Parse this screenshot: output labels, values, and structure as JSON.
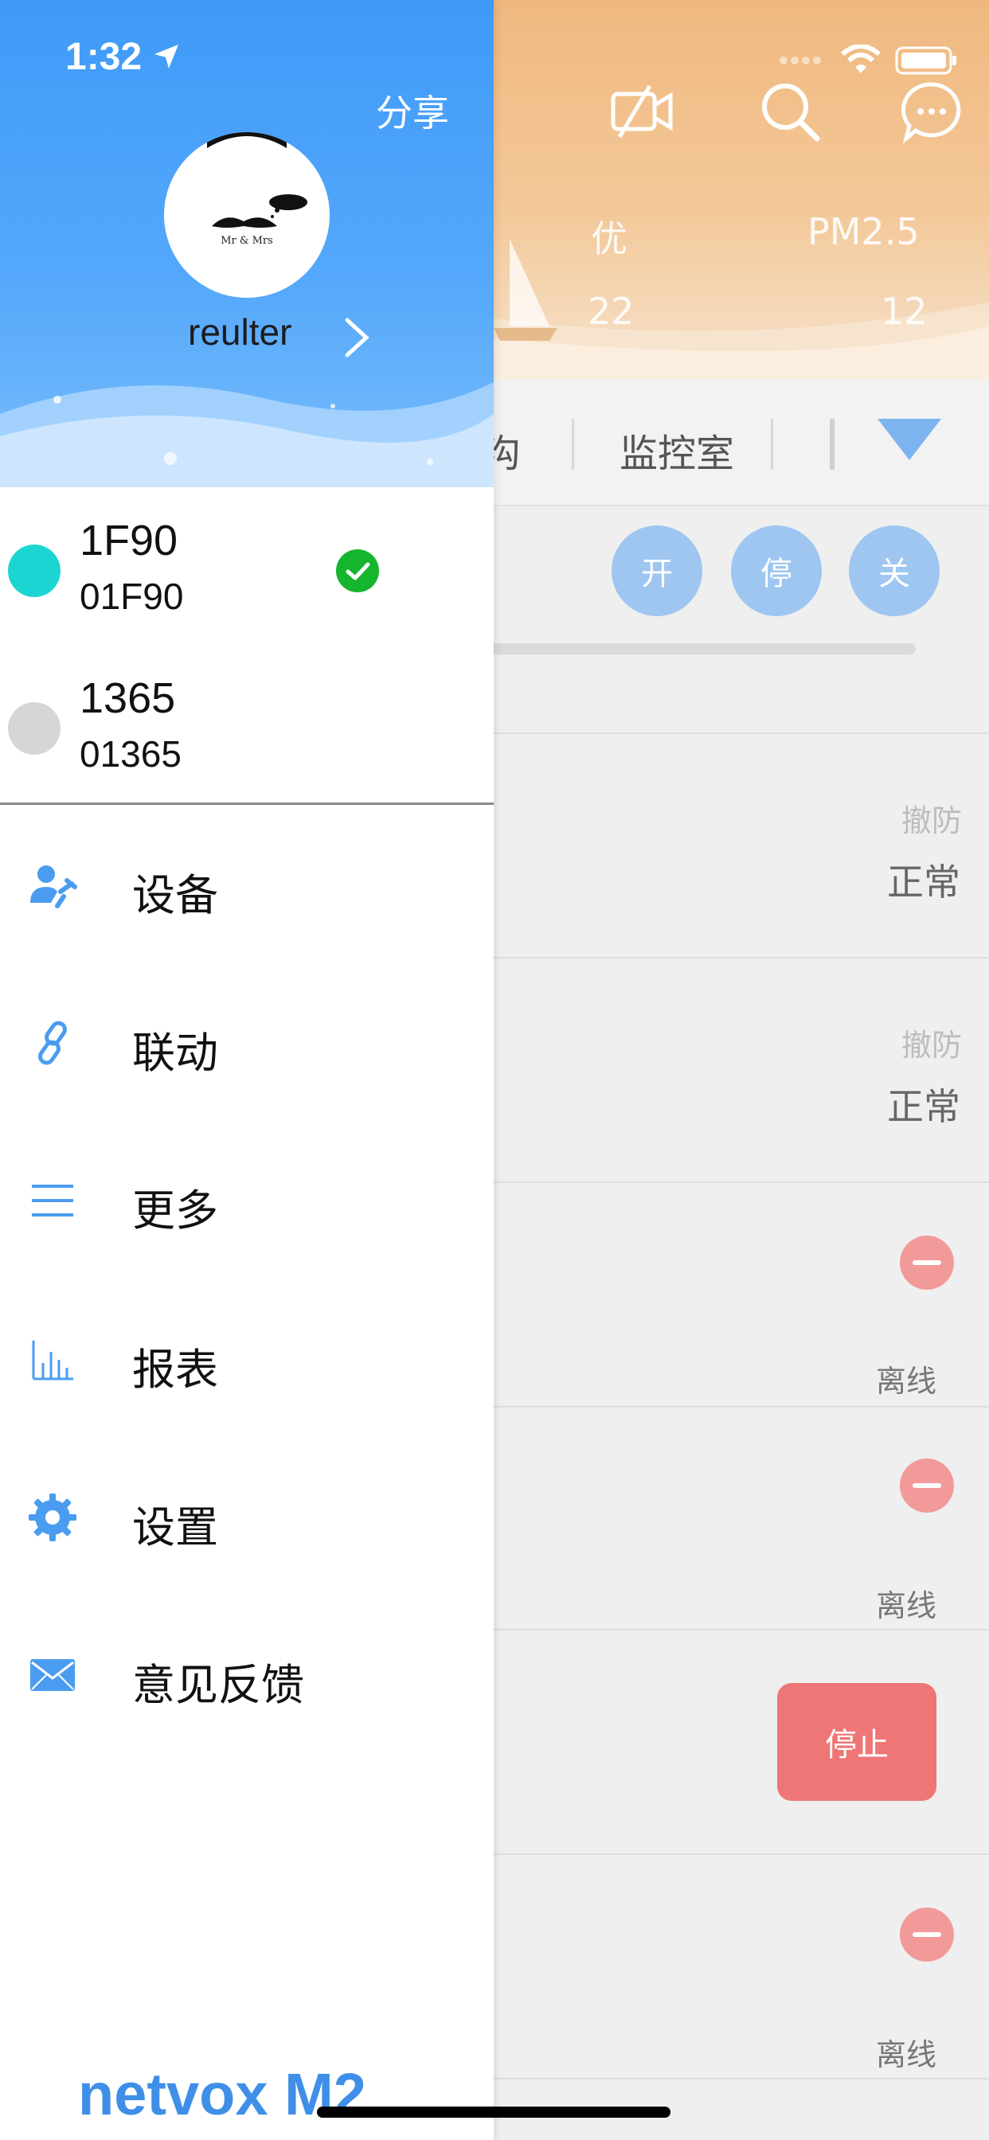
{
  "status_bar": {
    "time": "1:32"
  },
  "drawer": {
    "share_label": "分享",
    "username": "reulter",
    "avatar_caption": "Mr & Mrs",
    "gateways": [
      {
        "name": "1F90",
        "id": "01F90",
        "status_color": "#1cd5d2",
        "selected": true
      },
      {
        "name": "1365",
        "id": "01365",
        "status_color": "#d6d6d6",
        "selected": false
      }
    ],
    "menu": [
      {
        "label": "设备",
        "icon": "user-wrench-icon"
      },
      {
        "label": "联动",
        "icon": "link-icon"
      },
      {
        "label": "更多",
        "icon": "menu-lines-icon"
      },
      {
        "label": "报表",
        "icon": "bar-chart-icon"
      },
      {
        "label": "设置",
        "icon": "gear-icon"
      },
      {
        "label": "意见反馈",
        "icon": "envelope-icon"
      }
    ],
    "brand": "netvox M2"
  },
  "background": {
    "weather": {
      "aqi_label": "优",
      "aqi_value": "22",
      "pm_label": "PM2.5",
      "pm_value": "12"
    },
    "tabs": [
      "沟",
      "监控室"
    ],
    "controls": [
      "开",
      "停",
      "关"
    ],
    "rows": [
      {
        "state": "撤防",
        "status": "正常"
      },
      {
        "state": "撤防",
        "status": "正常"
      },
      {
        "status": "离线"
      },
      {
        "status": "离线"
      },
      {
        "action": "停止"
      },
      {
        "status": "离线"
      }
    ]
  },
  "colors": {
    "drawer_header": "#4aa3fa",
    "accent": "#3d97ef",
    "check": "#15b52e",
    "stop": "#ef7676"
  }
}
